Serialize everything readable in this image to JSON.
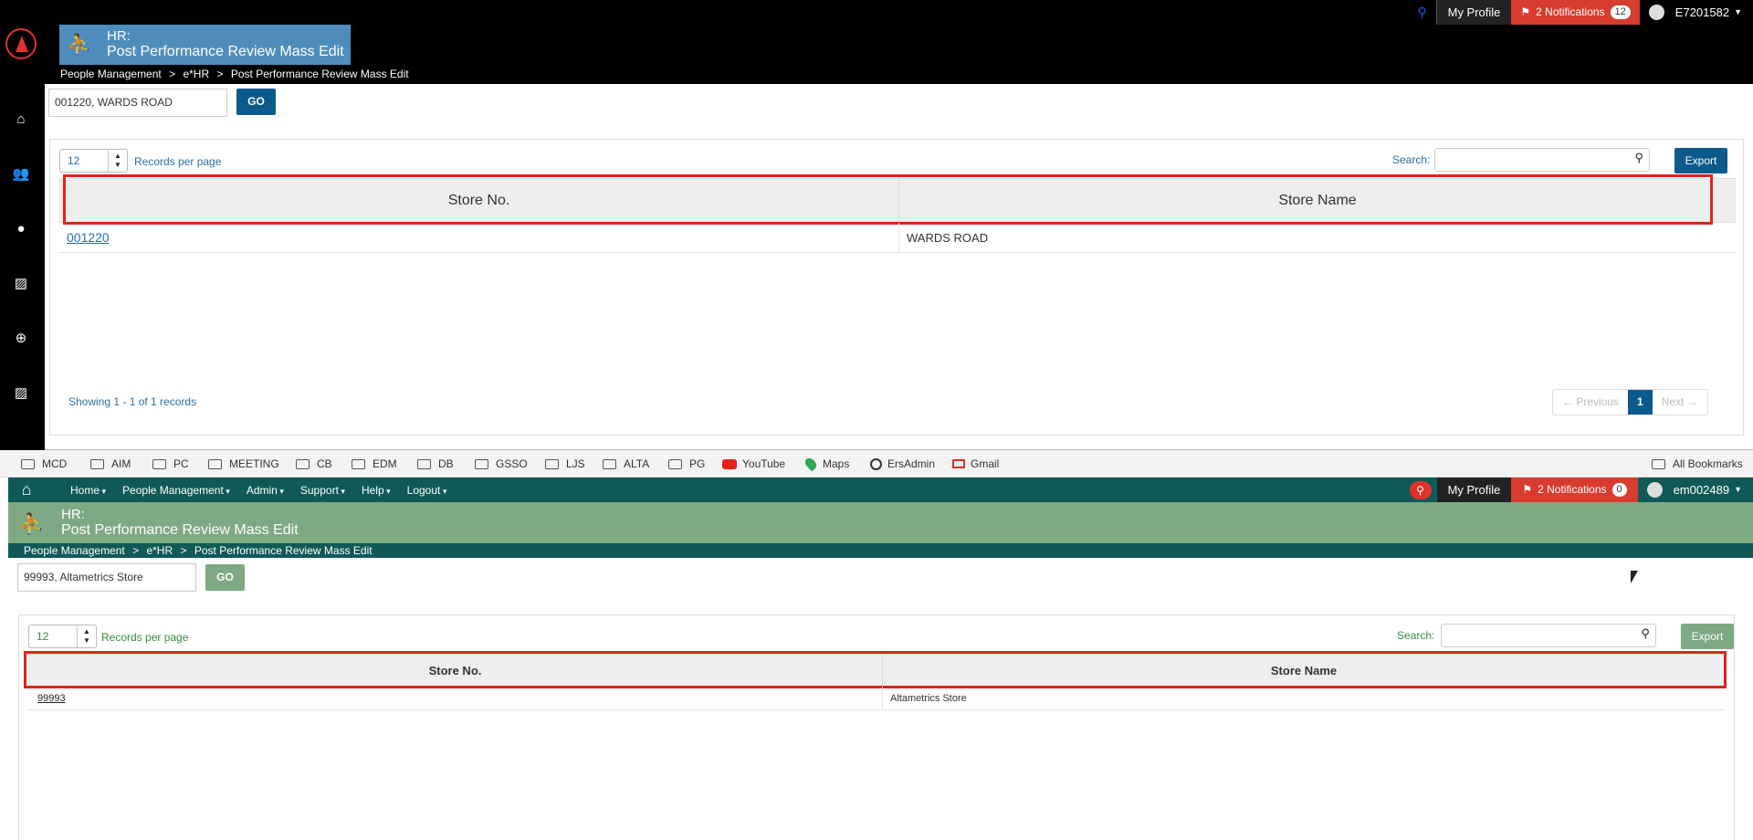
{
  "colors": {
    "top_accent": "#4f8dbd",
    "top_button": "#0a5a8c",
    "top_link": "#2a6fa8",
    "bottom_nav": "#0f5a56",
    "bottom_title": "#7ea982",
    "bottom_button": "#7ea982",
    "bottom_link": "#3a8a46",
    "highlight": "#e2231a",
    "notification": "#d83c2f"
  },
  "top": {
    "user_menu": {
      "my_profile": "My Profile",
      "notifications": "2 Notifications",
      "notif_count": "12",
      "user": "E7201582"
    },
    "title": {
      "line1": "HR:",
      "line2": "Post Performance Review Mass Edit"
    },
    "breadcrumb": [
      "People Management",
      ">",
      "e*HR",
      ">",
      "Post Performance Review Mass Edit"
    ],
    "store_input": "001220, WARDS ROAD",
    "go_label": "GO",
    "records_per_page": {
      "value": "12",
      "label": "Records per page"
    },
    "search_label": "Search:",
    "export_label": "Export",
    "table": {
      "headers": [
        "Store No.",
        "Store Name"
      ],
      "rows": [
        {
          "store_no": "001220",
          "store_name": "WARDS ROAD"
        }
      ]
    },
    "showing": "Showing 1 - 1 of 1 records",
    "pager": {
      "previous": "← Previous",
      "current": "1",
      "next": "Next →"
    },
    "sidebar_icons": [
      "home-icon",
      "users-icon",
      "user-icon",
      "broken-image-icon",
      "support-icon",
      "broken-image-icon"
    ]
  },
  "bookmarks": {
    "items": [
      "MCD",
      "AIM",
      "PC",
      "MEETING",
      "CB",
      "EDM",
      "DB",
      "GSSO",
      "LJS",
      "ALTA",
      "PG",
      "YouTube",
      "Maps",
      "ErsAdmin",
      "Gmail"
    ],
    "all": "All Bookmarks"
  },
  "bottom": {
    "menu": [
      "Home",
      "People Management",
      "Admin",
      "Support",
      "Help",
      "Logout"
    ],
    "user_menu": {
      "my_profile": "My Profile",
      "notifications": "2 Notifications",
      "notif_count": "0",
      "user": "em002489"
    },
    "title": {
      "line1": "HR:",
      "line2": "Post Performance Review Mass Edit"
    },
    "breadcrumb": [
      "People Management",
      ">",
      "e*HR",
      ">",
      "Post Performance Review Mass Edit"
    ],
    "store_input": "99993, Altametrics Store",
    "go_label": "GO",
    "records_per_page": {
      "value": "12",
      "label": "Records per page"
    },
    "search_label": "Search:",
    "export_label": "Export",
    "table": {
      "headers": [
        "Store No.",
        "Store Name"
      ],
      "rows": [
        {
          "store_no": "99993",
          "store_name": "Altametrics Store"
        }
      ]
    }
  }
}
